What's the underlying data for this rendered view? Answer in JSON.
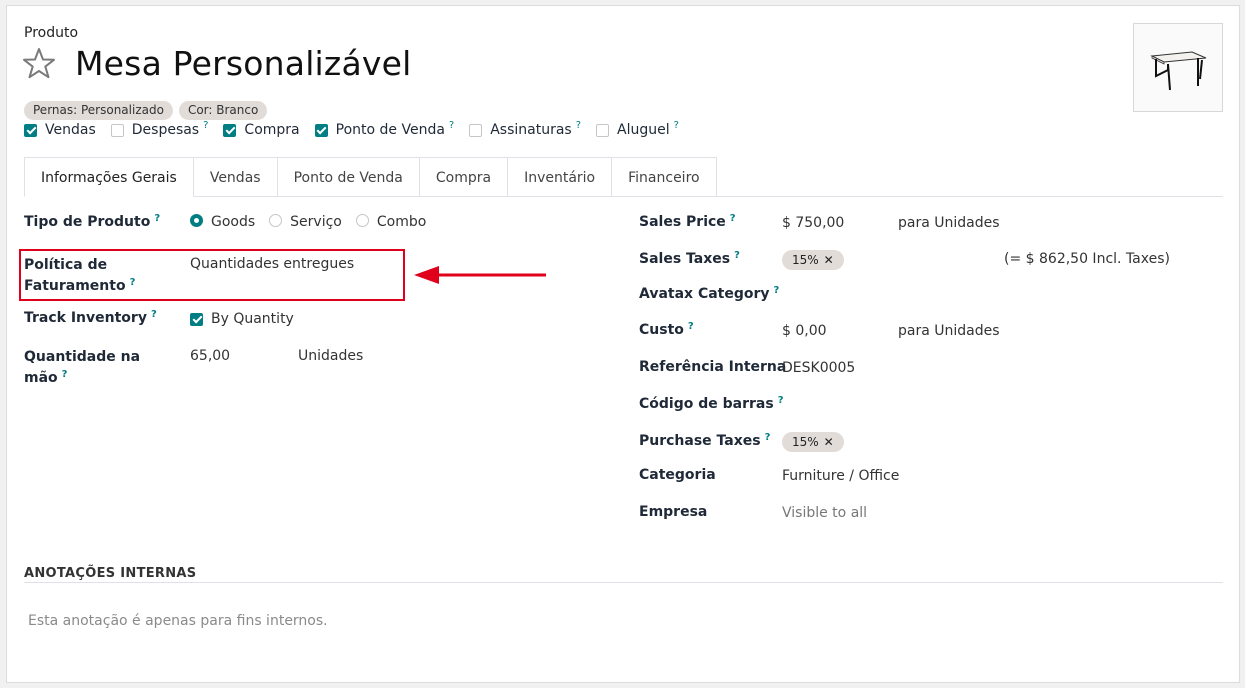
{
  "breadcrumb": "Produto",
  "product": {
    "name": "Mesa Personalizável"
  },
  "tags": [
    "Pernas: Personalizado",
    "Cor: Branco"
  ],
  "flags": [
    {
      "label": "Vendas",
      "checked": true,
      "help": false
    },
    {
      "label": "Despesas",
      "checked": false,
      "help": true
    },
    {
      "label": "Compra",
      "checked": true,
      "help": false
    },
    {
      "label": "Ponto de Venda",
      "checked": true,
      "help": true
    },
    {
      "label": "Assinaturas",
      "checked": false,
      "help": true
    },
    {
      "label": "Aluguel",
      "checked": false,
      "help": true
    }
  ],
  "help_mark": "?",
  "tabs": [
    "Informações Gerais",
    "Vendas",
    "Ponto de Venda",
    "Compra",
    "Inventário",
    "Financeiro"
  ],
  "left": {
    "product_type_label": "Tipo de Produto",
    "product_type_options": [
      "Goods",
      "Serviço",
      "Combo"
    ],
    "product_type_selected": "Goods",
    "invoice_policy_label_line1": "Política de",
    "invoice_policy_label_line2": "Faturamento",
    "invoice_policy_value": "Quantidades entregues",
    "track_inventory_label": "Track Inventory",
    "track_inventory_value": "By Quantity",
    "qty_label_line1": "Quantidade na",
    "qty_label_line2": "mão",
    "qty_value": "65,00",
    "qty_uom": "Unidades"
  },
  "right": {
    "sales_price_label": "Sales Price",
    "sales_price_value": "$ 750,00",
    "sales_price_uom": "para Unidades",
    "sales_taxes_label": "Sales Taxes",
    "sales_taxes_tag": "15%",
    "sales_taxes_incl": "(= $ 862,50 Incl. Taxes)",
    "avatax_label": "Avatax Category",
    "cost_label": "Custo",
    "cost_value": "$ 0,00",
    "cost_uom": "para Unidades",
    "ref_label": "Referência Interna",
    "ref_value": "DESK0005",
    "barcode_label": "Código de barras",
    "purchase_taxes_label": "Purchase Taxes",
    "purchase_taxes_tag": "15%",
    "category_label": "Categoria",
    "category_value": "Furniture / Office",
    "company_label": "Empresa",
    "company_value": "Visible to all"
  },
  "notes": {
    "title": "ANOTAÇÕES INTERNAS",
    "placeholder": "Esta anotação é apenas para fins internos."
  },
  "colors": {
    "accent": "#017e84",
    "annotation": "#e0001b",
    "tag_bg": "#e2dcd9"
  }
}
